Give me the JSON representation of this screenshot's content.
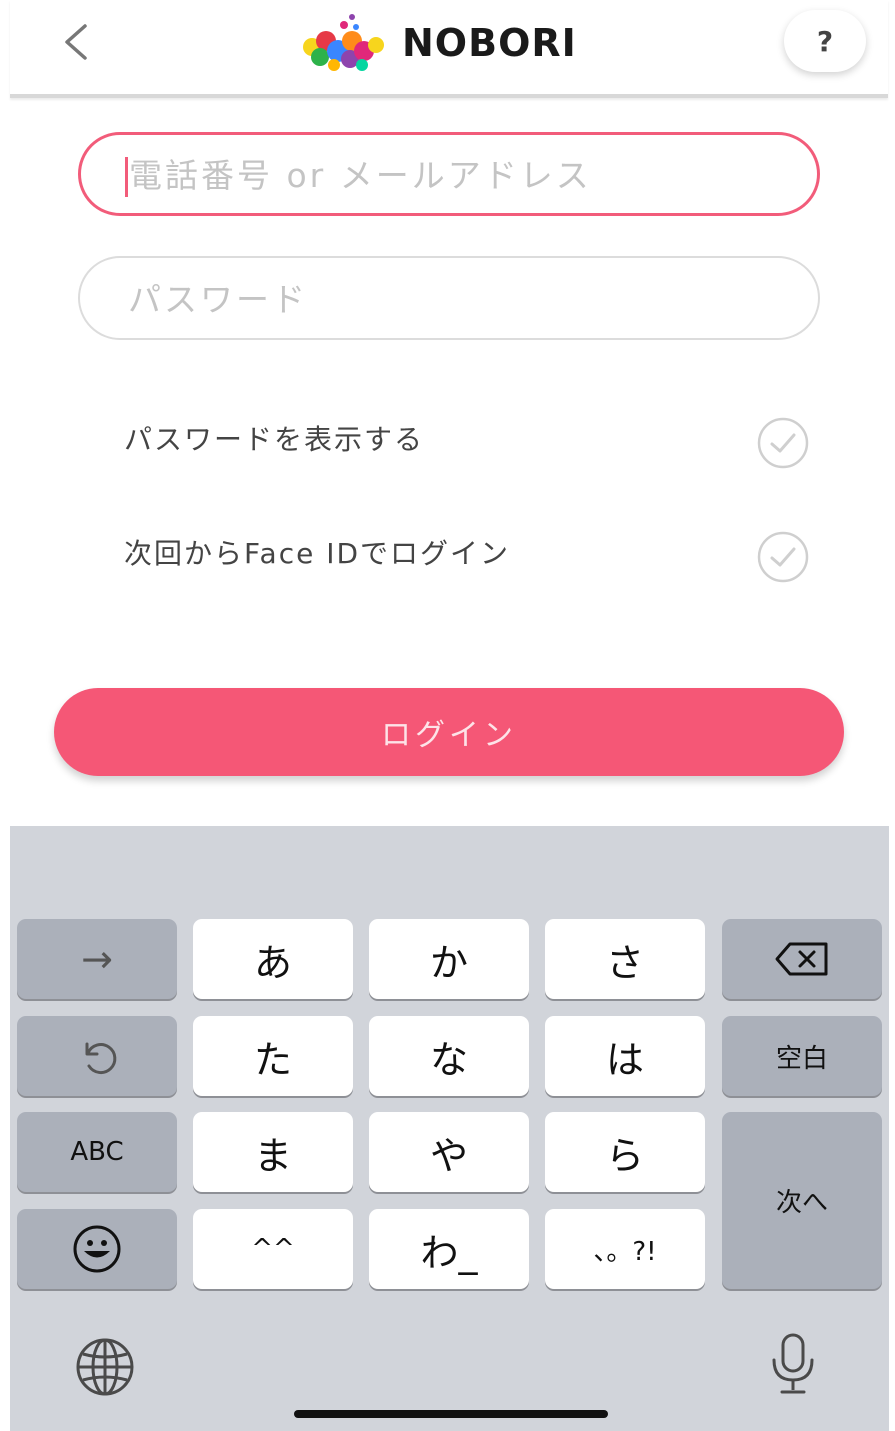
{
  "app": {
    "brand": "NOBORI",
    "help_label": "?"
  },
  "form": {
    "phone_placeholder": "電話番号 or メールアドレス",
    "password_placeholder": "パスワード",
    "show_password_label": "パスワードを表示する",
    "faceid_label": "次回からFace IDでログイン",
    "login_label": "ログイン"
  },
  "colors": {
    "accent": "#f55776",
    "field_focus": "#f25c7a"
  },
  "keyboard": {
    "kana_rows": [
      [
        "あ",
        "か",
        "さ"
      ],
      [
        "た",
        "な",
        "は"
      ],
      [
        "ま",
        "や",
        "ら"
      ],
      [
        "^^",
        "わ_",
        "、。?!"
      ]
    ],
    "abc_label": "ABC",
    "space_label": "空白",
    "next_label": "次へ",
    "arrow_label": "→",
    "icons": [
      "undo-icon",
      "emoji-icon",
      "backspace-icon",
      "globe-icon",
      "microphone-icon"
    ]
  }
}
